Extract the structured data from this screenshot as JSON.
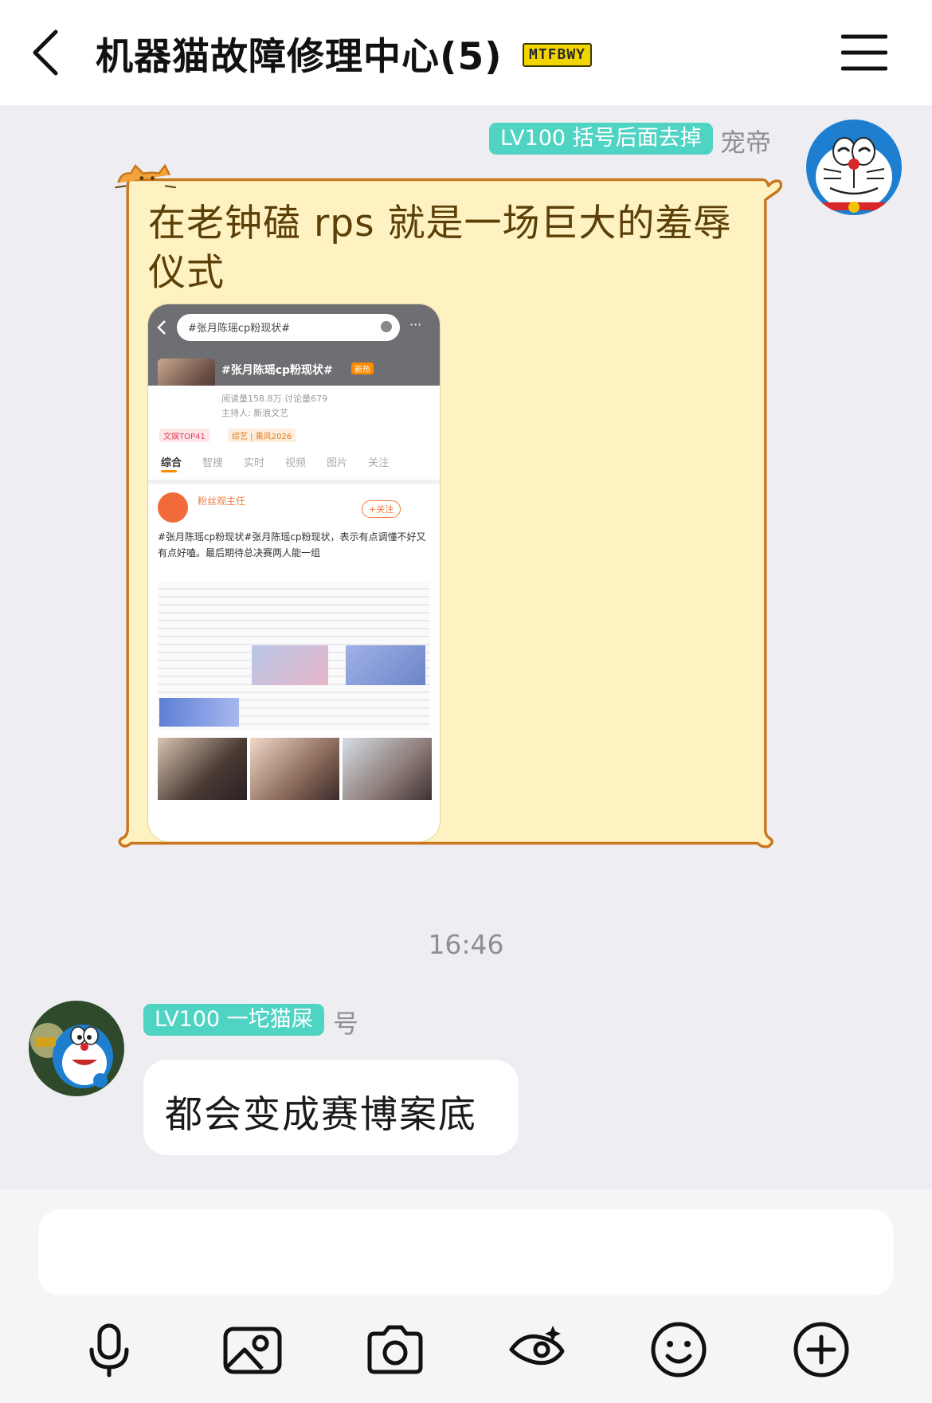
{
  "header": {
    "title": "机器猫故障修理中心(5)",
    "badge": "MTFBWY"
  },
  "messages": [
    {
      "side": "right",
      "level": "LV100 括号后面去掉",
      "sender": "宠帝",
      "text": "在老钟磕 rps 就是一场巨大的羞辱仪式",
      "bubble_style": "cat-frame",
      "image": {
        "search_text": "#张月陈瑶cp粉现状#",
        "topic_title": "#张月陈瑶cp粉现状#",
        "topic_tag": "新热",
        "stats": "阅读量158.8万 讨论量679",
        "host": "主持人: 新浪文艺",
        "chip1": "文娱TOP41",
        "chip2": "综艺 | 乘风2026",
        "tabs": [
          "综合",
          "智搜",
          "实时",
          "视频",
          "图片",
          "关注"
        ],
        "poster_name": "粉丝观主任",
        "follow_label": "+关注",
        "post_text": "#张月陈瑶cp粉现状#张月陈瑶cp粉现状，表示有点调懂不好又有点好嗑。最后期待总决赛两人能一组"
      }
    },
    {
      "side": "left",
      "timestamp": "16:46",
      "level": "LV100 一坨猫屎",
      "sender": "号",
      "text": "都会变成赛博案底"
    }
  ],
  "input": {
    "placeholder": ""
  },
  "toolbar": [
    "microphone-icon",
    "image-icon",
    "camera-icon",
    "game-icon",
    "emoji-icon",
    "plus-icon"
  ],
  "colors": {
    "level_badge": "#4fd3c3",
    "cat_bubble_fill": "#fef2c2",
    "cat_bubble_border": "#c9761b",
    "cat_bubble_text": "#5b3f07"
  }
}
